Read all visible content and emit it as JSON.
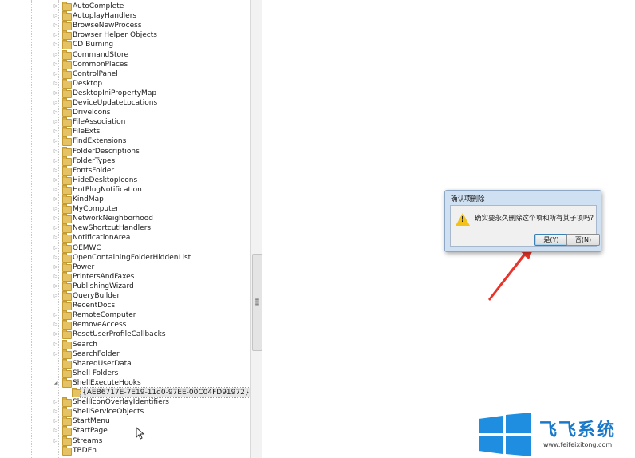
{
  "tree": {
    "items": [
      {
        "label": "AutoComplete",
        "expandable": true
      },
      {
        "label": "AutoplayHandlers",
        "expandable": true
      },
      {
        "label": "BrowseNewProcess",
        "expandable": true
      },
      {
        "label": "Browser Helper Objects",
        "expandable": true
      },
      {
        "label": "CD Burning",
        "expandable": true
      },
      {
        "label": "CommandStore",
        "expandable": true
      },
      {
        "label": "CommonPlaces",
        "expandable": true
      },
      {
        "label": "ControlPanel",
        "expandable": true
      },
      {
        "label": "Desktop",
        "expandable": true
      },
      {
        "label": "DesktopIniPropertyMap",
        "expandable": true
      },
      {
        "label": "DeviceUpdateLocations",
        "expandable": true
      },
      {
        "label": "DriveIcons",
        "expandable": true
      },
      {
        "label": "FileAssociation",
        "expandable": true
      },
      {
        "label": "FileExts",
        "expandable": true
      },
      {
        "label": "FindExtensions",
        "expandable": true
      },
      {
        "label": "FolderDescriptions",
        "expandable": true
      },
      {
        "label": "FolderTypes",
        "expandable": true
      },
      {
        "label": "FontsFolder",
        "expandable": true
      },
      {
        "label": "HideDesktopIcons",
        "expandable": true
      },
      {
        "label": "HotPlugNotification",
        "expandable": true
      },
      {
        "label": "KindMap",
        "expandable": true
      },
      {
        "label": "MyComputer",
        "expandable": true
      },
      {
        "label": "NetworkNeighborhood",
        "expandable": true
      },
      {
        "label": "NewShortcutHandlers",
        "expandable": true
      },
      {
        "label": "NotificationArea",
        "expandable": true
      },
      {
        "label": "OEMWC",
        "expandable": true
      },
      {
        "label": "OpenContainingFolderHiddenList",
        "expandable": true
      },
      {
        "label": "Power",
        "expandable": true
      },
      {
        "label": "PrintersAndFaxes",
        "expandable": true
      },
      {
        "label": "PublishingWizard",
        "expandable": true
      },
      {
        "label": "QueryBuilder",
        "expandable": true
      },
      {
        "label": "RecentDocs",
        "expandable": false
      },
      {
        "label": "RemoteComputer",
        "expandable": true
      },
      {
        "label": "RemoveAccess",
        "expandable": true
      },
      {
        "label": "ResetUserProfileCallbacks",
        "expandable": true
      },
      {
        "label": "Search",
        "expandable": true
      },
      {
        "label": "SearchFolder",
        "expandable": true
      },
      {
        "label": "SharedUserData",
        "expandable": false
      },
      {
        "label": "Shell Folders",
        "expandable": false
      },
      {
        "label": "ShellExecuteHooks",
        "expandable": true,
        "expanded": true
      },
      {
        "label": "{AEB6717E-7E19-11d0-97EE-00C04FD91972}",
        "expandable": false,
        "child": true,
        "selected": true
      },
      {
        "label": "ShellIconOverlayIdentifiers",
        "expandable": true
      },
      {
        "label": "ShellServiceObjects",
        "expandable": true
      },
      {
        "label": "StartMenu",
        "expandable": true
      },
      {
        "label": "StartPage",
        "expandable": true
      },
      {
        "label": "Streams",
        "expandable": true
      },
      {
        "label": "TBDEn",
        "expandable": false
      }
    ]
  },
  "dialog": {
    "title": "确认项删除",
    "message": "确实要永久删除这个项和所有其子项吗?",
    "yes_label": "是(Y)",
    "no_label": "否(N)",
    "icon": "warning-icon"
  },
  "watermark": {
    "brand": "飞飞系统",
    "url": "www.feifeixitong.com",
    "accent": "#1978c8"
  },
  "colors": {
    "folder": "#e5c365",
    "arrow": "#e8342a",
    "dialog_frame": "#cfe0f2"
  }
}
